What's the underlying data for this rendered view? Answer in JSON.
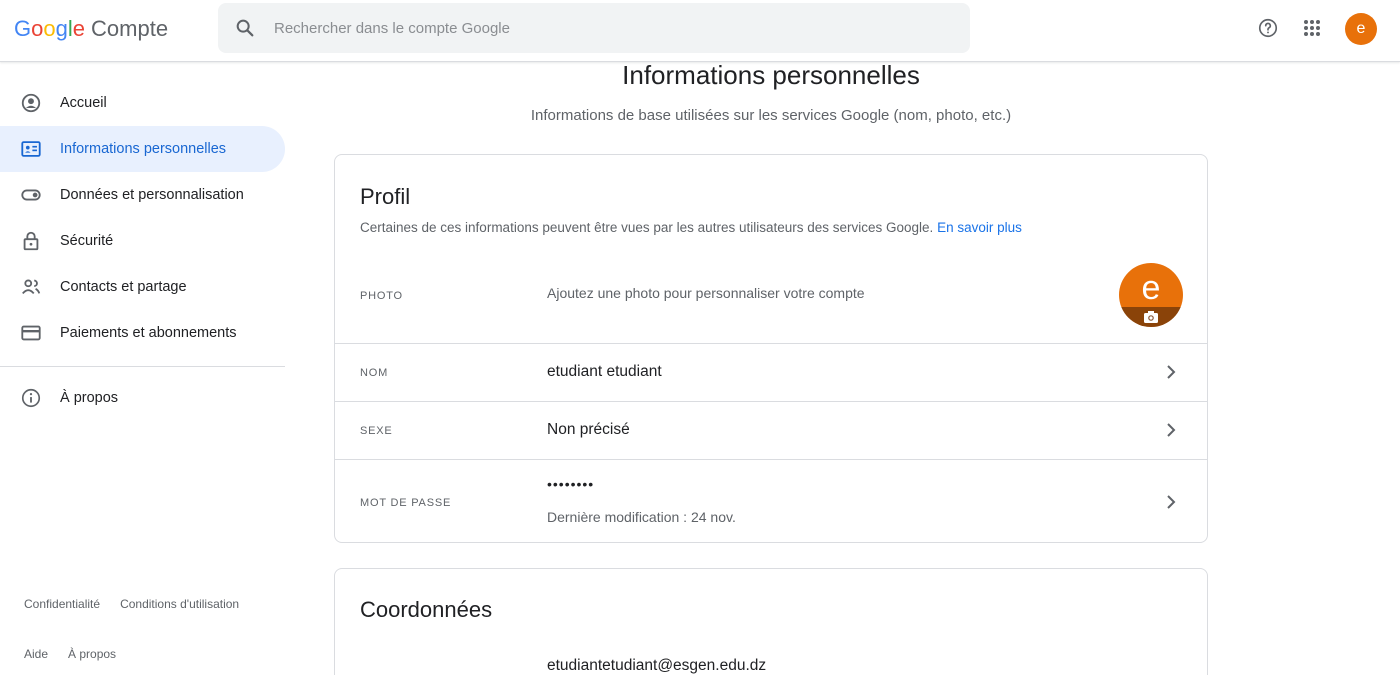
{
  "header": {
    "logo_letters": [
      {
        "ch": "G",
        "color": "#4285f4"
      },
      {
        "ch": "o",
        "color": "#ea4335"
      },
      {
        "ch": "o",
        "color": "#fbbc05"
      },
      {
        "ch": "g",
        "color": "#4285f4"
      },
      {
        "ch": "l",
        "color": "#34a853"
      },
      {
        "ch": "e",
        "color": "#ea4335"
      }
    ],
    "product": "Compte",
    "search_placeholder": "Rechercher dans le compte Google",
    "search_value": "",
    "help_icon": "help-circle-icon",
    "apps_icon": "apps-grid-icon",
    "avatar_letter": "e"
  },
  "sidebar": {
    "items": [
      {
        "label": "Accueil",
        "icon": "account-circle-icon",
        "active": false
      },
      {
        "label": "Informations personnelles",
        "icon": "id-card-icon",
        "active": true
      },
      {
        "label": "Données et personnalisation",
        "icon": "toggle-icon",
        "active": false
      },
      {
        "label": "Sécurité",
        "icon": "lock-icon",
        "active": false
      },
      {
        "label": "Contacts et partage",
        "icon": "people-icon",
        "active": false
      },
      {
        "label": "Paiements et abonnements",
        "icon": "credit-card-icon",
        "active": false
      }
    ],
    "about_item": {
      "label": "À propos",
      "icon": "info-icon"
    },
    "footer_row1": [
      "Confidentialité",
      "Conditions d'utilisation"
    ],
    "footer_row2": [
      "Aide",
      "À propos"
    ]
  },
  "main": {
    "title": "Informations personnelles",
    "subtitle": "Informations de base utilisées sur les services Google (nom, photo, etc.)",
    "profile": {
      "title": "Profil",
      "description": "Certaines de ces informations peuvent être vues par les autres utilisateurs des services Google.",
      "learn_more": "En savoir plus",
      "photo_label": "PHOTO",
      "photo_hint": "Ajoutez une photo pour personnaliser votre compte",
      "avatar_letter": "e",
      "name_label": "NOM",
      "name_value": "etudiant etudiant",
      "gender_label": "SEXE",
      "gender_value": "Non précisé",
      "password_label": "MOT DE PASSE",
      "password_value": "••••••••",
      "password_hint": "Dernière modification : 24 nov."
    },
    "contact": {
      "title": "Coordonnées",
      "email_value": "etudiantetudiant@esgen.edu.dz"
    }
  },
  "colors": {
    "accent_orange": "#e8710a",
    "link_blue": "#1a73e8",
    "active_bg": "#e8f0fe",
    "active_text": "#1967d2"
  }
}
